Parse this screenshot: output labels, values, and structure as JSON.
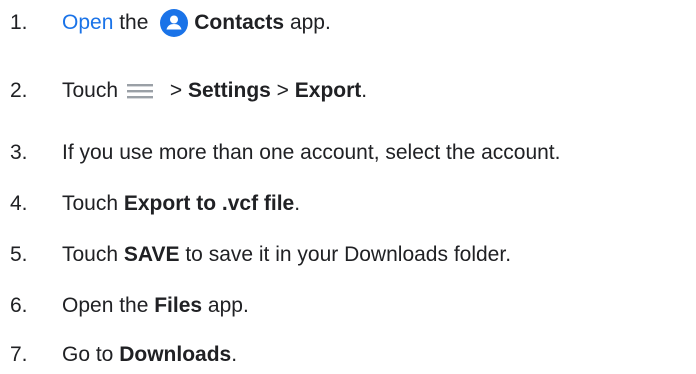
{
  "steps": [
    {
      "number": "1.",
      "link": "Open",
      "text_a": " the ",
      "bold": "Contacts",
      "text_b": " app."
    },
    {
      "number": "2.",
      "text_a": "Touch",
      "sep_a": " > ",
      "bold_a": "Settings",
      "sep_b": " > ",
      "bold_b": "Export",
      "text_b": "."
    },
    {
      "number": "3.",
      "text": "If you use more than one account, select the account."
    },
    {
      "number": "4.",
      "text_a": "Touch ",
      "bold": "Export to .vcf file",
      "text_b": "."
    },
    {
      "number": "5.",
      "text_a": "Touch ",
      "bold": "SAVE",
      "text_b": " to save it in your Downloads folder."
    },
    {
      "number": "6.",
      "text_a": "Open the ",
      "bold": "Files",
      "text_b": " app."
    },
    {
      "number": "7.",
      "text_a": "Go to ",
      "bold": "Downloads",
      "text_b": "."
    }
  ],
  "icons": {
    "contacts": "contacts-app-icon",
    "menu": "menu-icon"
  },
  "colors": {
    "link": "#1a73e8",
    "contacts_icon_bg": "#1a73e8",
    "menu_icon": "#9aa0a6",
    "text": "#202124"
  }
}
